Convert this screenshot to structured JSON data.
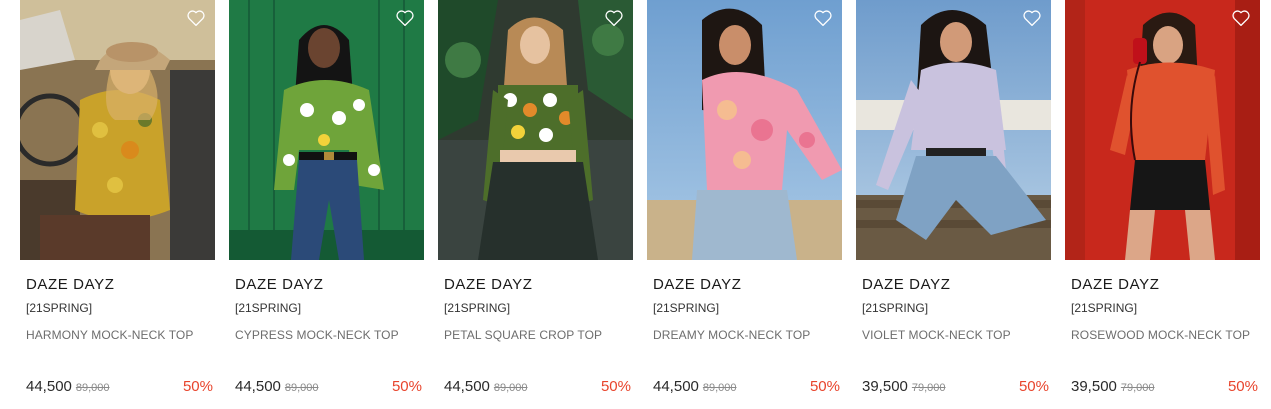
{
  "products": [
    {
      "brand": "DAZE DAYZ",
      "season": "[21SPRING]",
      "name": "HARMONY MOCK-NECK TOP",
      "price": "44,500",
      "original_price": "89,000",
      "discount": "50%",
      "photo_icon": "model-yellow-floral-top-photo"
    },
    {
      "brand": "DAZE DAYZ",
      "season": "[21SPRING]",
      "name": "CYPRESS MOCK-NECK TOP",
      "price": "44,500",
      "original_price": "89,000",
      "discount": "50%",
      "photo_icon": "model-green-floral-top-photo"
    },
    {
      "brand": "DAZE DAYZ",
      "season": "[21SPRING]",
      "name": "PETAL SQUARE CROP TOP",
      "price": "44,500",
      "original_price": "89,000",
      "discount": "50%",
      "photo_icon": "model-floral-crop-top-photo"
    },
    {
      "brand": "DAZE DAYZ",
      "season": "[21SPRING]",
      "name": "DREAMY MOCK-NECK TOP",
      "price": "44,500",
      "original_price": "89,000",
      "discount": "50%",
      "photo_icon": "model-pink-print-top-photo"
    },
    {
      "brand": "DAZE DAYZ",
      "season": "[21SPRING]",
      "name": "VIOLET MOCK-NECK TOP",
      "price": "39,500",
      "original_price": "79,000",
      "discount": "50%",
      "photo_icon": "model-lilac-top-photo"
    },
    {
      "brand": "DAZE DAYZ",
      "season": "[21SPRING]",
      "name": "ROSEWOOD MOCK-NECK TOP",
      "price": "39,500",
      "original_price": "79,000",
      "discount": "50%",
      "photo_icon": "model-red-top-photo"
    }
  ],
  "colors": {
    "discount": "#e8442c",
    "brand_text": "#1a1a1a",
    "name_text": "#6d6d6d",
    "price_text": "#2a2a2a",
    "original_price_text": "#8a8a8a",
    "heart_outline": "#ffffff"
  },
  "icons": {
    "wishlist": "heart-icon"
  }
}
